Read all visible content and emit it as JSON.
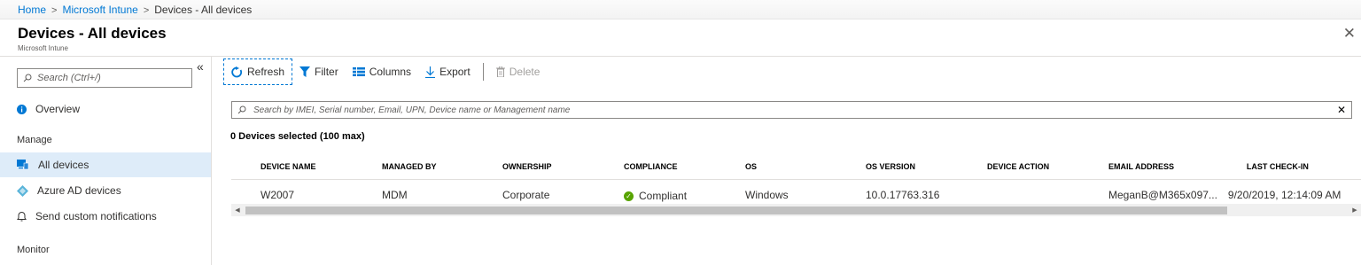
{
  "breadcrumb": {
    "home": "Home",
    "intune": "Microsoft Intune",
    "current": "Devices - All devices",
    "sep": ">"
  },
  "header": {
    "title": "Devices - All devices",
    "subtitle": "Microsoft Intune",
    "close": "✕"
  },
  "sidebar": {
    "search_placeholder": "Search (Ctrl+/)",
    "collapse": "«",
    "overview": "Overview",
    "manage_heading": "Manage",
    "items": [
      {
        "label": "All devices"
      },
      {
        "label": "Azure AD devices"
      },
      {
        "label": "Send custom notifications"
      }
    ],
    "monitor_heading": "Monitor"
  },
  "toolbar": {
    "refresh": "Refresh",
    "filter": "Filter",
    "columns": "Columns",
    "export": "Export",
    "delete": "Delete"
  },
  "search": {
    "placeholder": "Search by IMEI, Serial number, Email, UPN, Device name or Management name",
    "clear": "✕"
  },
  "selection": "0 Devices selected (100 max)",
  "table": {
    "columns": [
      "DEVICE NAME",
      "MANAGED BY",
      "OWNERSHIP",
      "COMPLIANCE",
      "OS",
      "OS VERSION",
      "DEVICE ACTION",
      "EMAIL ADDRESS",
      "LAST CHECK-IN"
    ],
    "rows": [
      {
        "device_name": "W2007",
        "managed_by": "MDM",
        "ownership": "Corporate",
        "compliance": "Compliant",
        "os": "Windows",
        "os_version": "10.0.17763.316",
        "device_action": "",
        "email": "MeganB@M365x097...",
        "last_checkin": "9/20/2019, 12:14:09 AM"
      }
    ]
  },
  "colors": {
    "accent": "#0078d4",
    "selected_nav": "#deecf9",
    "compliant": "#57a300"
  }
}
